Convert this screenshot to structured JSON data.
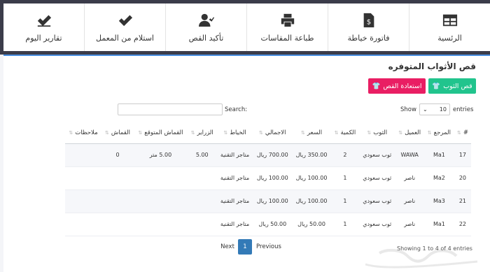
{
  "nav": [
    {
      "label": "الرئسية",
      "icon": "grid-icon"
    },
    {
      "label": "فاتورة خياطة",
      "icon": "invoice-icon"
    },
    {
      "label": "طباعة المقاسات",
      "icon": "printer-icon"
    },
    {
      "label": "تأكيد القص",
      "icon": "user-check-icon"
    },
    {
      "label": "استلام من المعمل",
      "icon": "check-icon"
    },
    {
      "label": "تقارير اليوم",
      "icon": "double-check-icon"
    }
  ],
  "page_title": "قص الأثواب المتوفره",
  "buttons": {
    "cut": "قص الثوب",
    "restore": "استعادة القص"
  },
  "table_controls": {
    "show": "Show",
    "entries": "entries",
    "page_length": "10",
    "search": "Search:"
  },
  "columns": [
    "#",
    "المرجع",
    "العميل",
    "الثوب",
    "الكمية",
    "السعر",
    "الاجمالي",
    "الخياط",
    "الزراير",
    "القماش المتوقع",
    "القماش",
    "ملاحظات"
  ],
  "rows": [
    [
      "17",
      "Ma1",
      "WAWA",
      "ثوب سعودي",
      "2",
      "350.00 ريال",
      "700.00 ريال",
      "متاجر التقنية",
      "5.00",
      "5.00 متر",
      "0",
      ""
    ],
    [
      "20",
      "Ma2",
      "ناصر",
      "ثوب سعودي",
      "1",
      "100.00 ريال",
      "100.00 ريال",
      "متاجر التقنية",
      "",
      "",
      "",
      ""
    ],
    [
      "21",
      "Ma3",
      "ناصر",
      "ثوب سعودي",
      "1",
      "100.00 ريال",
      "100.00 ريال",
      "متاجر التقنية",
      "",
      "",
      "",
      ""
    ],
    [
      "22",
      "Ma1",
      "ناصر",
      "ثوب سعودي",
      "1",
      "50.00 ريال",
      "50.00 ريال",
      "متاجر التقنية",
      "",
      "",
      "",
      ""
    ]
  ],
  "footer": {
    "info": "Showing 1 to 4 of 4 entries",
    "next": "Next",
    "page": "1",
    "previous": "Previous"
  },
  "colors": {
    "topbar": "#3b3c4a",
    "accent": "#4a90e2",
    "green": "#21c48d",
    "pink": "#e91e63",
    "page_active": "#337ab7"
  }
}
